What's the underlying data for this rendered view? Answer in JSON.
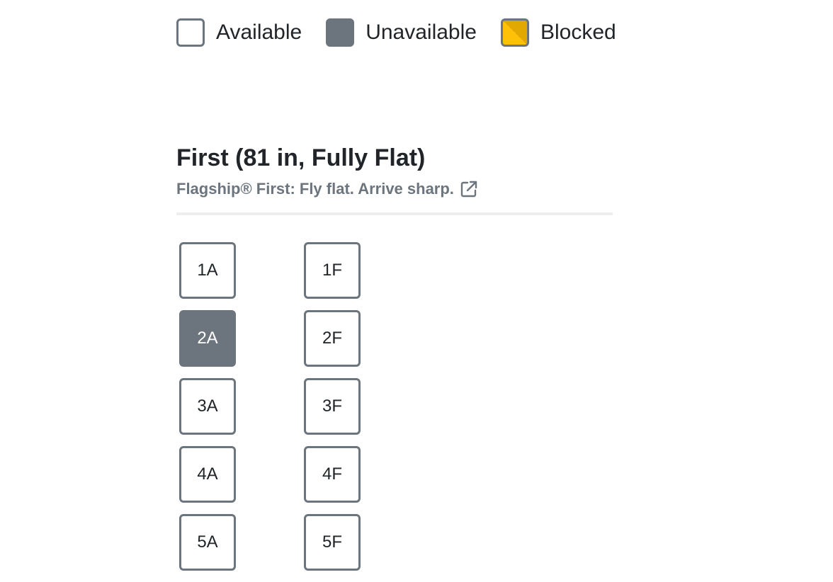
{
  "legend": {
    "available": "Available",
    "unavailable": "Unavailable",
    "blocked": "Blocked"
  },
  "colors": {
    "seat_border": "#6c757d",
    "unavailable": "#6c757d",
    "blocked_light": "#ffc107",
    "blocked_dark": "#e0a800"
  },
  "cabin": {
    "title": "First (81 in, Fully Flat)",
    "subtitle": "Flagship® First: Fly flat. Arrive sharp.",
    "link_icon": "external-link-icon"
  },
  "seats": {
    "rows": [
      {
        "left": "1A",
        "left_status": "available",
        "right": "1F",
        "right_status": "available"
      },
      {
        "left": "2A",
        "left_status": "unavailable",
        "right": "2F",
        "right_status": "available"
      },
      {
        "left": "3A",
        "left_status": "available",
        "right": "3F",
        "right_status": "available"
      },
      {
        "left": "4A",
        "left_status": "available",
        "right": "4F",
        "right_status": "available"
      },
      {
        "left": "5A",
        "left_status": "available",
        "right": "5F",
        "right_status": "available"
      }
    ]
  }
}
